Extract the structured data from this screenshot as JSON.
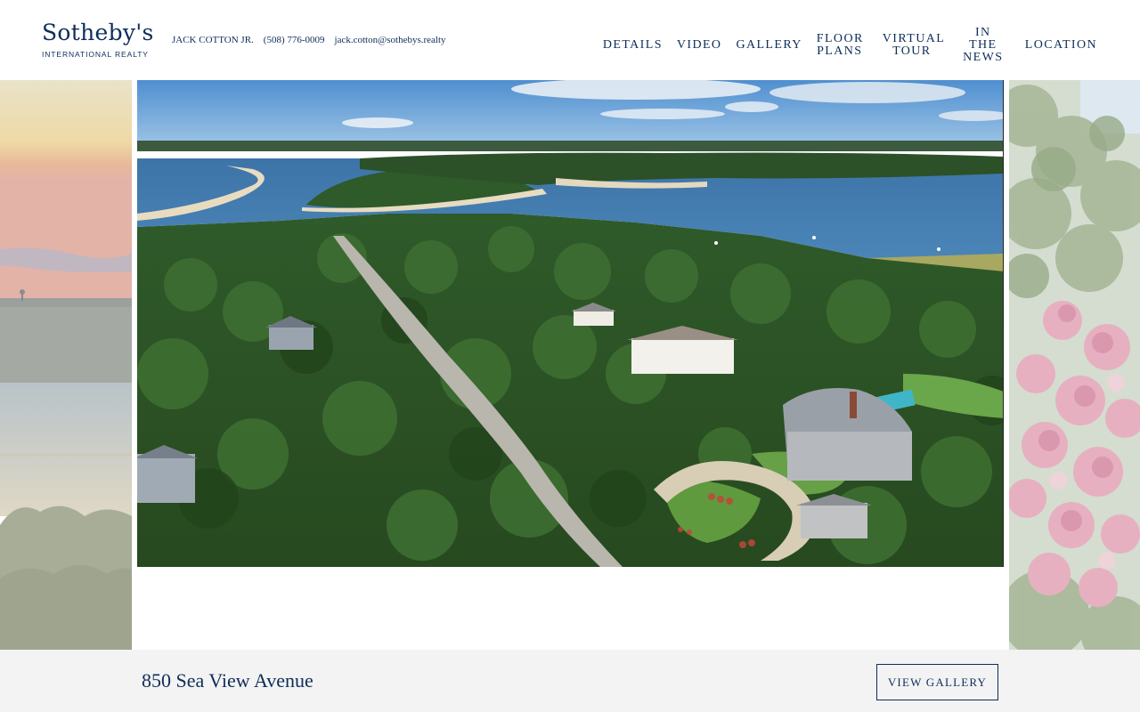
{
  "brand": {
    "name": "Sotheby's",
    "subtitle": "INTERNATIONAL REALTY"
  },
  "contact": {
    "agent": "JACK COTTON JR.",
    "phone": "(508) 776-0009",
    "email": "jack.cotton@sothebys.realty"
  },
  "nav": {
    "details": "DETAILS",
    "video": "VIDEO",
    "gallery": "GALLERY",
    "floor_plans": "FLOOR PLANS",
    "virtual_tour": "VIRTUAL TOUR",
    "in_the_news": "IN THE NEWS",
    "location": "LOCATION"
  },
  "listing": {
    "address": "850 Sea View Avenue",
    "gallery_button": "VIEW GALLERY"
  },
  "colors": {
    "brand_navy": "#0e2d5a",
    "footer_bg": "#f3f3f3"
  }
}
